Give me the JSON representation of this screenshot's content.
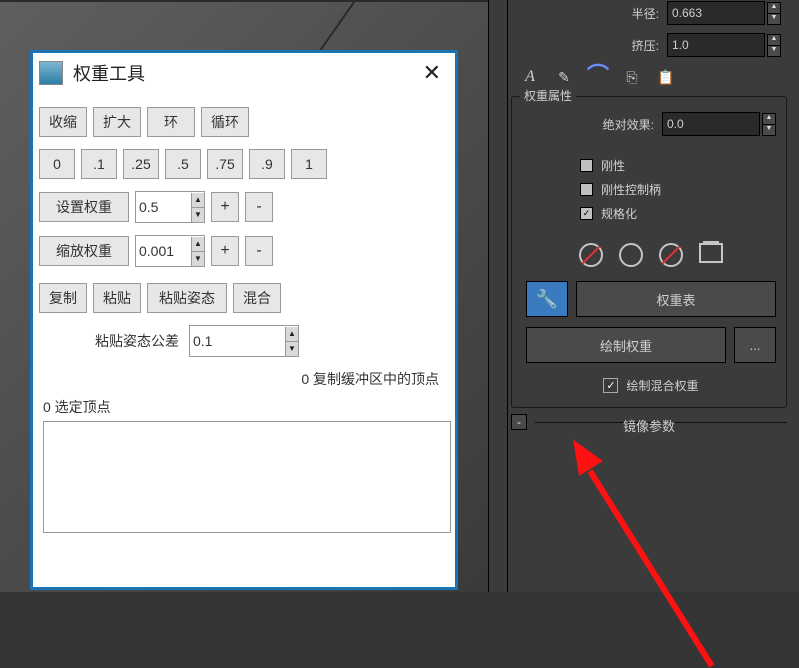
{
  "dialog": {
    "title": "权重工具",
    "nav": {
      "shrink": "收缩",
      "grow": "扩大",
      "ring": "环",
      "loop": "循环"
    },
    "presets": [
      "0",
      ".1",
      ".25",
      ".5",
      ".75",
      ".9",
      "1"
    ],
    "setWeight": {
      "label": "设置权重",
      "value": "0.5"
    },
    "scaleWeight": {
      "label": "缩放权重",
      "value": "0.001"
    },
    "plus": "+",
    "minus": "-",
    "clipboard": {
      "copy": "复制",
      "paste": "粘贴",
      "pastePose": "粘贴姿态",
      "blend": "混合"
    },
    "tolerance": {
      "label": "粘贴姿态公差",
      "value": "0.1"
    },
    "bufferInfo": "0 复制缓冲区中的顶点",
    "selectedLabel": "0 选定顶点"
  },
  "side": {
    "radius": {
      "label": "半径:",
      "value": "0.663"
    },
    "squash": {
      "label": "挤压:",
      "value": "1.0"
    },
    "attrs": {
      "title": "权重属性",
      "absEffect": {
        "label": "绝对效果:",
        "value": "0.0"
      },
      "rigid": "刚性",
      "rigidHandle": "刚性控制柄",
      "normalize": "规格化"
    },
    "weightTable": "权重表",
    "paintWeights": "绘制权重",
    "ellipsis": "...",
    "paintBlend": "绘制混合权重",
    "mirrorTitle": "镜像参数"
  }
}
